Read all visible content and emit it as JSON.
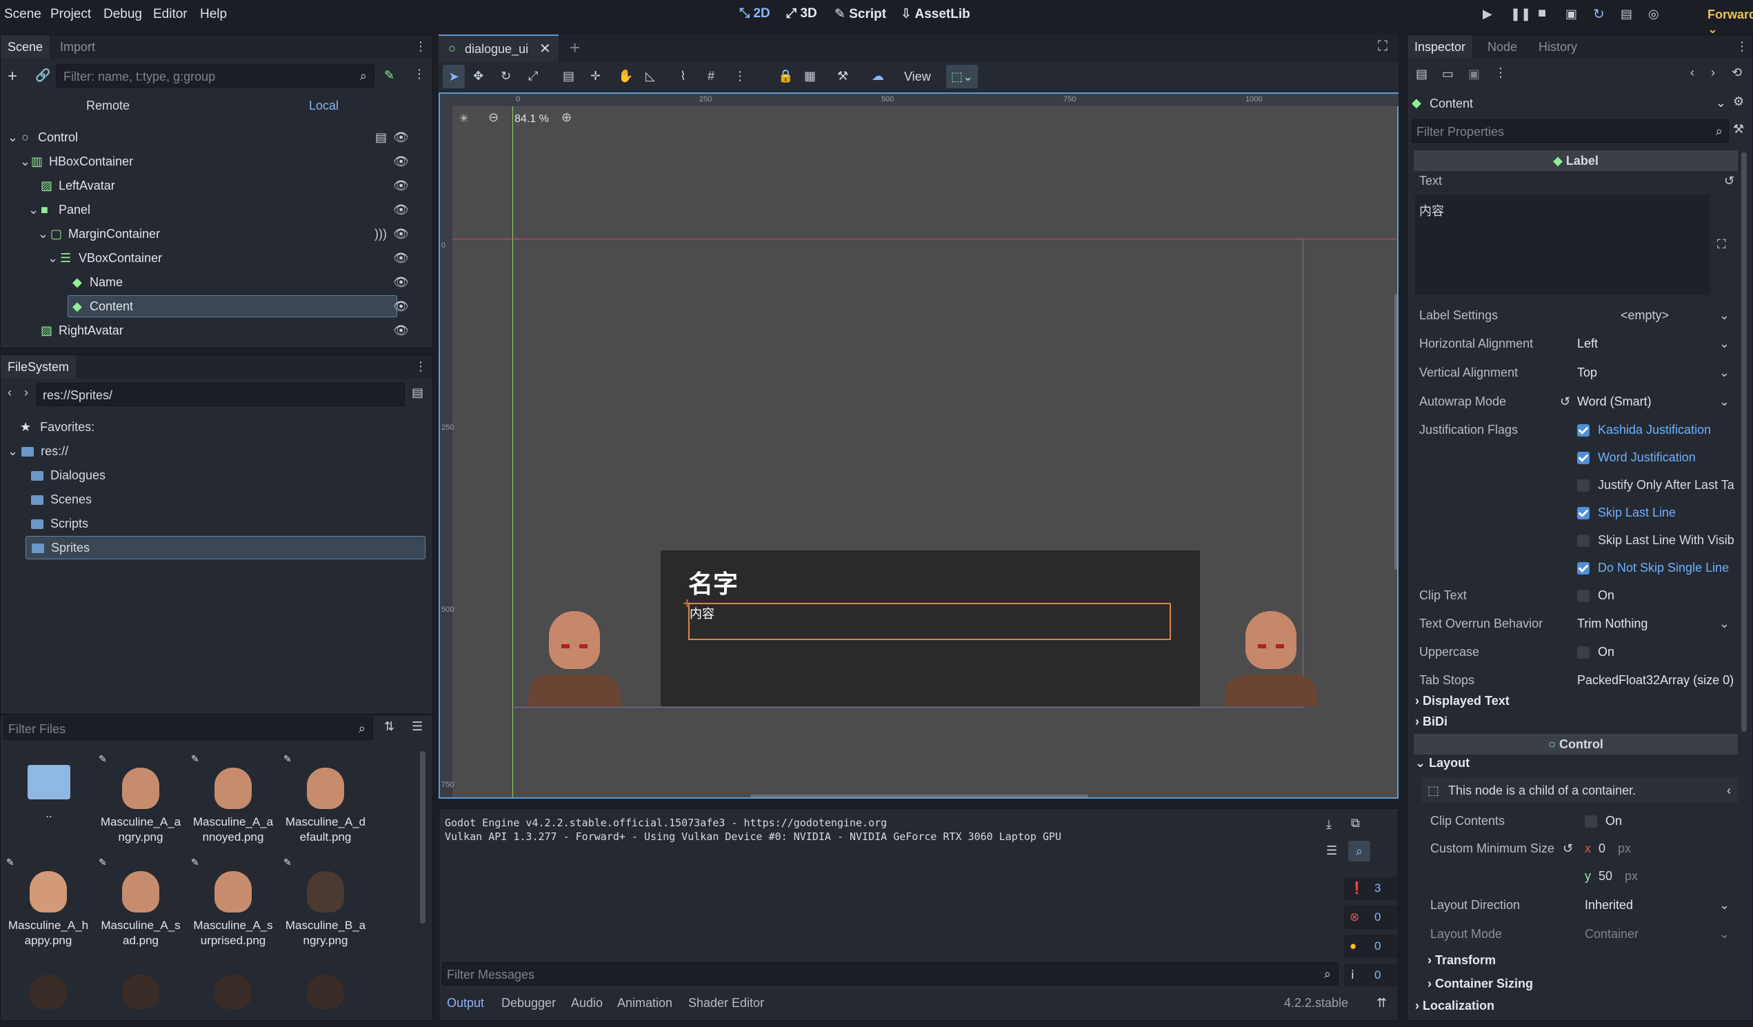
{
  "menu": [
    "Scene",
    "Project",
    "Debug",
    "Editor",
    "Help"
  ],
  "workspaces": [
    "2D",
    "3D",
    "Script",
    "AssetLib"
  ],
  "renderer": "Forward+",
  "scene_dock": {
    "tabs": [
      "Scene",
      "Import"
    ],
    "filter_placeholder": "Filter: name, t:type, g:group",
    "remote": "Remote",
    "local": "Local",
    "nodes": [
      "Control",
      "HBoxContainer",
      "LeftAvatar",
      "Panel",
      "MarginContainer",
      "VBoxContainer",
      "Name",
      "Content",
      "RightAvatar"
    ]
  },
  "filesystem": {
    "title": "FileSystem",
    "path": "res://Sprites/",
    "favorites": "Favorites:",
    "root": "res://",
    "folders": [
      "Dialogues",
      "Scenes",
      "Scripts",
      "Sprites"
    ],
    "filter_placeholder": "Filter Files",
    "files": [
      {
        "name": "..",
        "kind": "folder"
      },
      {
        "name": "Masculine_A_angry.png",
        "l1": "Masculine_A_a",
        "l2": "ngry.png"
      },
      {
        "name": "Masculine_A_annoyed.png",
        "l1": "Masculine_A_a",
        "l2": "nnoyed.png"
      },
      {
        "name": "Masculine_A_default.png",
        "l1": "Masculine_A_d",
        "l2": "efault.png"
      },
      {
        "name": "Masculine_A_happy.png",
        "l1": "Masculine_A_h",
        "l2": "appy.png"
      },
      {
        "name": "Masculine_A_sad.png",
        "l1": "Masculine_A_s",
        "l2": "ad.png"
      },
      {
        "name": "Masculine_A_surprised.png",
        "l1": "Masculine_A_s",
        "l2": "urprised.png"
      },
      {
        "name": "Masculine_B_angry.png",
        "l1": "Masculine_B_a",
        "l2": "ngry.png"
      }
    ]
  },
  "editor": {
    "tab": "dialogue_ui",
    "zoom": "84.1 %",
    "view": "View",
    "ruler_top": [
      "0",
      "250",
      "500",
      "750",
      "1000"
    ],
    "ruler_left": [
      "0",
      "250",
      "500",
      "750"
    ],
    "dialog_name": "名字",
    "dialog_content": "内容"
  },
  "output": {
    "lines": [
      "Godot Engine v4.2.2.stable.official.15073afe3 - https://godotengine.org",
      "Vulkan API 1.3.277 - Forward+ - Using Vulkan Device #0: NVIDIA - NVIDIA GeForce RTX 3060 Laptop GPU"
    ],
    "filter_placeholder": "Filter Messages",
    "counters": [
      "3",
      "0",
      "0",
      "0"
    ],
    "tabs": [
      "Output",
      "Debugger",
      "Audio",
      "Animation",
      "Shader Editor"
    ],
    "version": "4.2.2.stable"
  },
  "inspector": {
    "tabs": [
      "Inspector",
      "Node",
      "History"
    ],
    "node": "Content",
    "filter_placeholder": "Filter Properties",
    "section_label": "Label",
    "text_label": "Text",
    "text_value": "内容",
    "props": {
      "label_settings": {
        "label": "Label Settings",
        "value": "<empty>"
      },
      "h_align": {
        "label": "Horizontal Alignment",
        "value": "Left"
      },
      "v_align": {
        "label": "Vertical Alignment",
        "value": "Top"
      },
      "autowrap": {
        "label": "Autowrap Mode",
        "value": "Word (Smart)"
      },
      "just_flags": {
        "label": "Justification Flags"
      },
      "clip_text": {
        "label": "Clip Text",
        "value": "On"
      },
      "overrun": {
        "label": "Text Overrun Behavior",
        "value": "Trim Nothing"
      },
      "uppercase": {
        "label": "Uppercase",
        "value": "On"
      },
      "tab_stops": {
        "label": "Tab Stops",
        "value": "PackedFloat32Array (size 0)"
      }
    },
    "flags": [
      {
        "label": "Kashida Justification",
        "checked": true
      },
      {
        "label": "Word Justification",
        "checked": true
      },
      {
        "label": "Justify Only After Last Ta",
        "checked": false
      },
      {
        "label": "Skip Last Line",
        "checked": true
      },
      {
        "label": "Skip Last Line With Visib",
        "checked": false
      },
      {
        "label": "Do Not Skip Single Line",
        "checked": true
      }
    ],
    "displayed_text": "Displayed Text",
    "bidi": "BiDi",
    "control_section": "Control",
    "layout": "Layout",
    "container_note": "This node is a child of a container.",
    "clip_contents": {
      "label": "Clip Contents",
      "value": "On"
    },
    "min_size": {
      "label": "Custom Minimum Size",
      "x": "0",
      "y": "50",
      "unit": "px"
    },
    "layout_direction": {
      "label": "Layout Direction",
      "value": "Inherited"
    },
    "layout_mode": {
      "label": "Layout Mode",
      "value": "Container"
    },
    "transform": "Transform",
    "container_sizing": "Container Sizing",
    "localization": "Localization"
  },
  "colors": {
    "accent": "#5b9bd5",
    "selection": "#3a4654",
    "node_green": "#8eef97",
    "error": "#e05555",
    "warning": "#f2c335"
  }
}
